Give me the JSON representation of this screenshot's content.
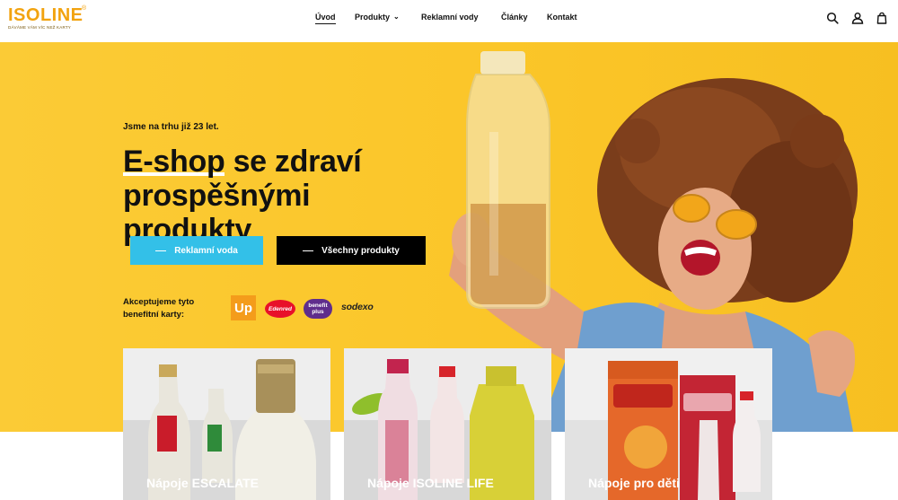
{
  "brand": {
    "logo_text": "ISOLINE",
    "tagline": "DÁVÁME VÁM VÍC NEŽ KARTY",
    "accent_color": "#fbc629"
  },
  "nav": {
    "items": [
      {
        "label": "Úvod",
        "active": true
      },
      {
        "label": "Produkty",
        "has_dropdown": true
      },
      {
        "label": "Reklamní vody"
      },
      {
        "label": "Články"
      },
      {
        "label": "Kontakt"
      }
    ],
    "icons": [
      "search-icon",
      "account-icon",
      "cart-icon"
    ]
  },
  "hero": {
    "kicker": "Jsme na trhu již 23 let.",
    "headline_first": "E-shop",
    "headline_rest": " se zdraví prospěšnými produkty",
    "buttons": [
      {
        "label": "Reklamní voda",
        "color": "#33c0e8"
      },
      {
        "label": "Všechny produkty",
        "color": "#000000"
      }
    ],
    "benefit_label": "Akceptujeme tyto benefitní karty:",
    "benefit_cards": [
      "Up",
      "Edenred",
      "benefit plus",
      "sodexo"
    ]
  },
  "categories": [
    {
      "title": "Nápoje ESCALATE"
    },
    {
      "title": "Nápoje ISOLINE LIFE"
    },
    {
      "title": "Nápoje pro děti"
    }
  ]
}
